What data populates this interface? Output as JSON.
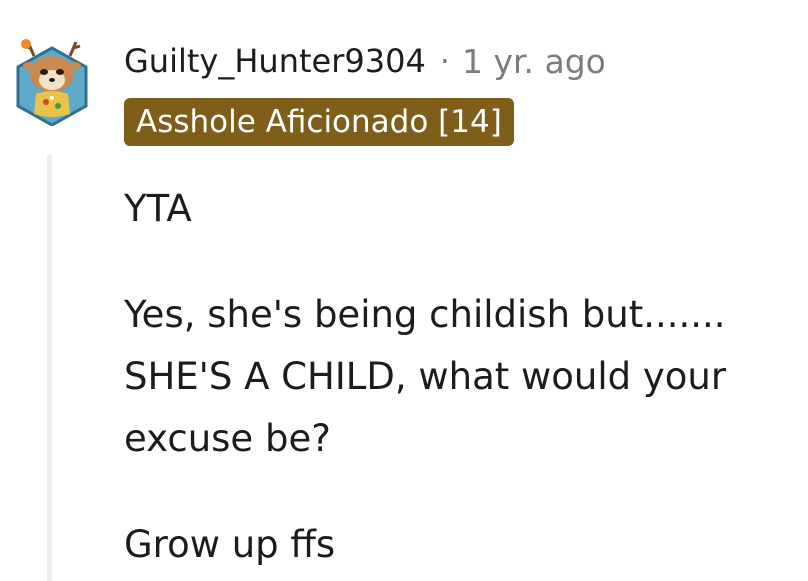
{
  "comment": {
    "author": "Guilty_Hunter9304",
    "separator": "·",
    "age": "1 yr. ago",
    "flair": "Asshole Aficionado [14]",
    "flair_color": "#7e5e18",
    "avatar_icon": "deer-avatar-icon",
    "paragraphs": {
      "p1": "YTA",
      "p2_line1": "Yes, she's being childish but.......",
      "p2_line2": "SHE'S A CHILD, what would your",
      "p2_line3": "excuse be?",
      "p3": "Grow up ffs"
    }
  }
}
